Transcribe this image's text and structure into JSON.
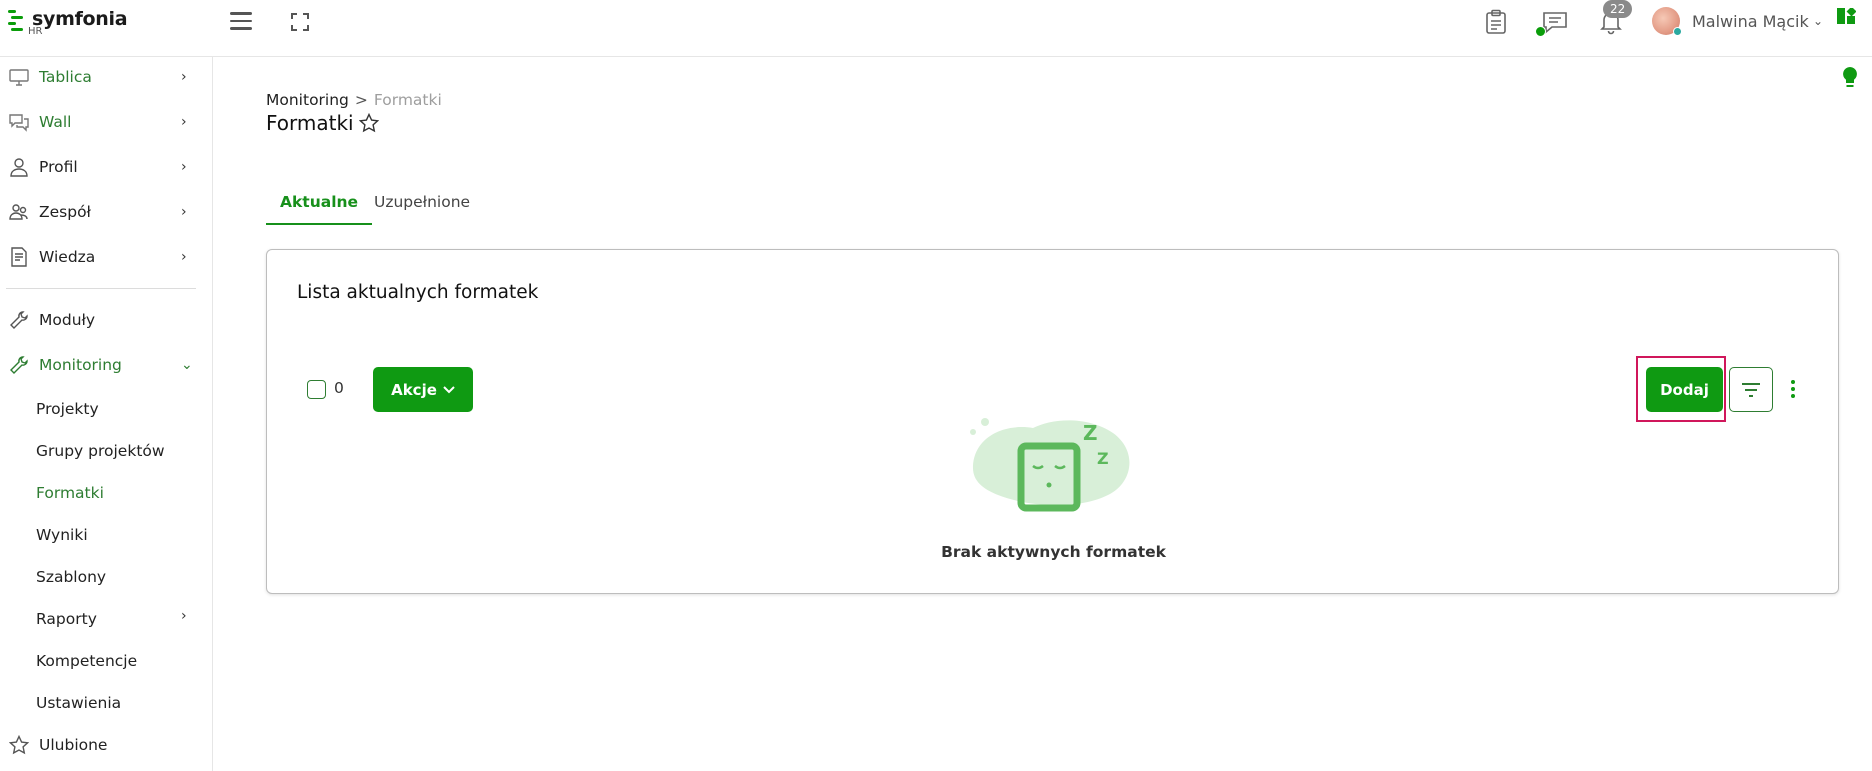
{
  "brand": {
    "name": "symfonia",
    "sub": "HR",
    "accent": "#0f9a12",
    "highlight": "#d0175b"
  },
  "topbar": {
    "notifications_count": "22",
    "user_name": "Malwina Mącik"
  },
  "sidebar": {
    "items": [
      {
        "label": "Tablica",
        "icon": "monitor-icon"
      },
      {
        "label": "Wall",
        "icon": "chat-bubbles-icon"
      },
      {
        "label": "Profil",
        "icon": "person-icon"
      },
      {
        "label": "Zespół",
        "icon": "team-icon"
      },
      {
        "label": "Wiedza",
        "icon": "document-icon"
      },
      {
        "label": "Moduły",
        "icon": "wrench-icon"
      },
      {
        "label": "Monitoring",
        "icon": "wrench-icon"
      }
    ],
    "monitoring_sub": [
      "Projekty",
      "Grupy projektów",
      "Formatki",
      "Wyniki",
      "Szablony",
      "Raporty",
      "Kompetencje",
      "Ustawienia"
    ],
    "favorites": "Ulubione"
  },
  "breadcrumb": {
    "parent": "Monitoring",
    "separator": ">",
    "current": "Formatki"
  },
  "page": {
    "title": "Formatki"
  },
  "tabs": [
    {
      "label": "Aktualne",
      "active": true
    },
    {
      "label": "Uzupełnione",
      "active": false
    }
  ],
  "card": {
    "title": "Lista aktualnych formatek",
    "selected_count": "0",
    "actions_label": "Akcje",
    "add_label": "Dodaj",
    "empty_text": "Brak aktywnych formatek"
  }
}
